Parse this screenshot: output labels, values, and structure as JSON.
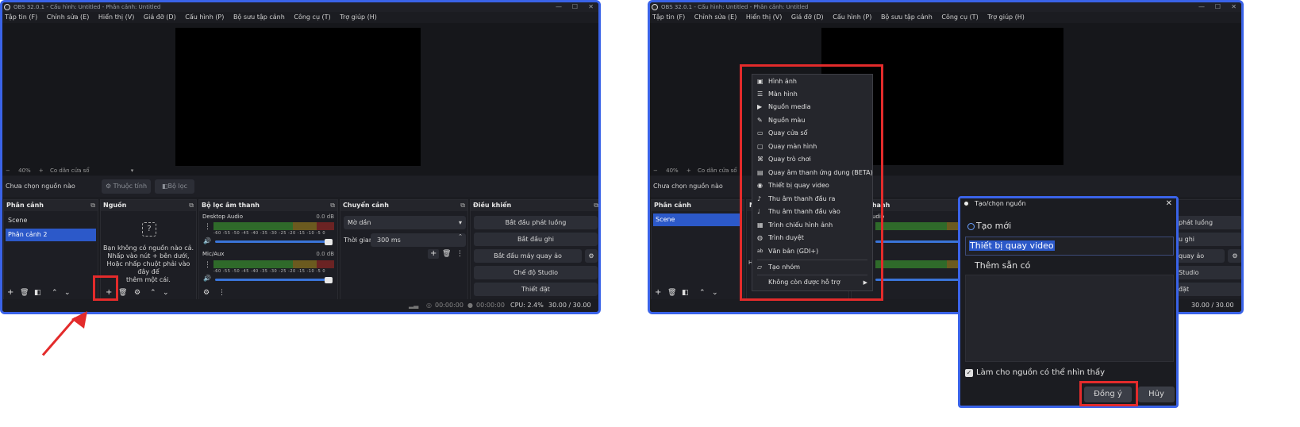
{
  "window_title": "OBS 32.0.1 - Cấu hình: Untitled - Phân cảnh: Untitled",
  "window_controls": {
    "minimize": "—",
    "maximize": "☐",
    "close": "✕"
  },
  "menu": [
    "Tập tin (F)",
    "Chỉnh sửa (E)",
    "Hiển thị (V)",
    "Giá đỡ (D)",
    "Cấu hình (P)",
    "Bộ sưu tập cảnh",
    "Công cụ (T)",
    "Trợ giúp (H)"
  ],
  "zoom": {
    "minus": "−",
    "percent": "40%",
    "plus": "+",
    "fit_label": "Co dãn cửa sổ",
    "dropdown": "▾"
  },
  "source_bar": {
    "no_source": "Chưa chọn nguồn nào",
    "properties": "Thuộc tính",
    "filters": "Bộ lọc"
  },
  "docks": {
    "scenes": {
      "title": "Phân cảnh",
      "items": [
        "Scene",
        "Phân cảnh 2"
      ]
    },
    "sources": {
      "title": "Nguồn",
      "empty_icon": "?",
      "empty_text": [
        "Bạn không có nguồn nào cả.",
        "Nhấp vào nút + bên dưới,",
        "Hoặc nhấp chuột phải vào đây để",
        "thêm một cái."
      ]
    },
    "mixer": {
      "title": "Bộ lọc âm thanh",
      "channels": [
        {
          "name": "Desktop Audio",
          "db": "0.0 dB"
        },
        {
          "name": "Mic/Aux",
          "db": "0.0 dB"
        }
      ],
      "ticks": "-60 -55 -50 -45 -40 -35 -30 -25 -20 -15 -10 -5 0"
    },
    "transitions": {
      "title": "Chuyển cảnh",
      "selected": "Mờ dần",
      "duration_label": "Thời gian",
      "duration_value": "300 ms"
    },
    "controls": {
      "title": "Điều khiển",
      "buttons": [
        "Bắt đầu phát luồng",
        "Bắt đầu ghi",
        "Bắt đầu máy quay ảo",
        "Chế độ Studio",
        "Thiết đặt"
      ]
    }
  },
  "status": {
    "rec_time1": "00:00:00",
    "rec_time2": "00:00:00",
    "cpu": "CPU: 2.4%",
    "fps": "30.00 / 30.00 FPS"
  },
  "right_partial": {
    "mixer_head": "Bộ lọc âm thanh",
    "mixer_head_visible": "thanh",
    "dock_letter": "N",
    "audio_fragment": "udio",
    "controls_fragments": [
      "Bắt đầu phát luồng",
      "Bắt đầu ghi",
      "Bắt đầu máy quay ảo",
      "Chế độ Studio",
      "Thiết đặt"
    ],
    "controls_visible": [
      "phát luồng",
      "u ghi",
      "quay ảo",
      "Studio",
      "đặt"
    ],
    "mic_fragment": "Ho"
  },
  "context_menu": {
    "items": [
      {
        "icon": "image-icon",
        "glyph": "▣",
        "label": "Hình ảnh"
      },
      {
        "icon": "list-icon",
        "glyph": "☰",
        "label": "Màn hình"
      },
      {
        "icon": "play-icon",
        "glyph": "▶",
        "label": "Nguồn media"
      },
      {
        "icon": "brush-icon",
        "glyph": "✎",
        "label": "Nguồn màu"
      },
      {
        "icon": "window-icon",
        "glyph": "▭",
        "label": "Quay cửa sổ"
      },
      {
        "icon": "monitor-icon",
        "glyph": "▢",
        "label": "Quay màn hình"
      },
      {
        "icon": "gamepad-icon",
        "glyph": "⌘",
        "label": "Quay trò chơi"
      },
      {
        "icon": "app-audio-icon",
        "glyph": "▤",
        "label": "Quay âm thanh ứng dụng (BETA)"
      },
      {
        "icon": "camera-icon",
        "glyph": "◉",
        "label": "Thiết bị quay video"
      },
      {
        "icon": "speaker-icon",
        "glyph": "♪",
        "label": "Thu âm thanh đầu ra"
      },
      {
        "icon": "mic-icon",
        "glyph": "♩",
        "label": "Thu âm thanh đầu vào"
      },
      {
        "icon": "slideshow-icon",
        "glyph": "▦",
        "label": "Trình chiếu hình ảnh"
      },
      {
        "icon": "globe-icon",
        "glyph": "◍",
        "label": "Trình duyệt"
      },
      {
        "icon": "text-icon",
        "glyph": "ab",
        "label": "Văn bản (GDI+)"
      }
    ],
    "group": {
      "icon": "folder-icon",
      "glyph": "▱",
      "label": "Tạo nhóm"
    },
    "deprecated": {
      "label": "Không còn được hỗ trợ",
      "arrow": "▶"
    }
  },
  "dialog": {
    "title": "Tạo/chọn nguồn",
    "close": "✕",
    "create_new": "Tạo mới",
    "name_value": "Thiết bị quay video",
    "add_existing": "Thêm sẵn có",
    "visible_label": "Làm cho nguồn có thể nhìn thấy",
    "ok": "Đồng ý",
    "cancel": "Hủy"
  },
  "colors": {
    "highlight_red": "#e32b2b",
    "window_border": "#3a63e8",
    "selection": "#2c59c9"
  }
}
